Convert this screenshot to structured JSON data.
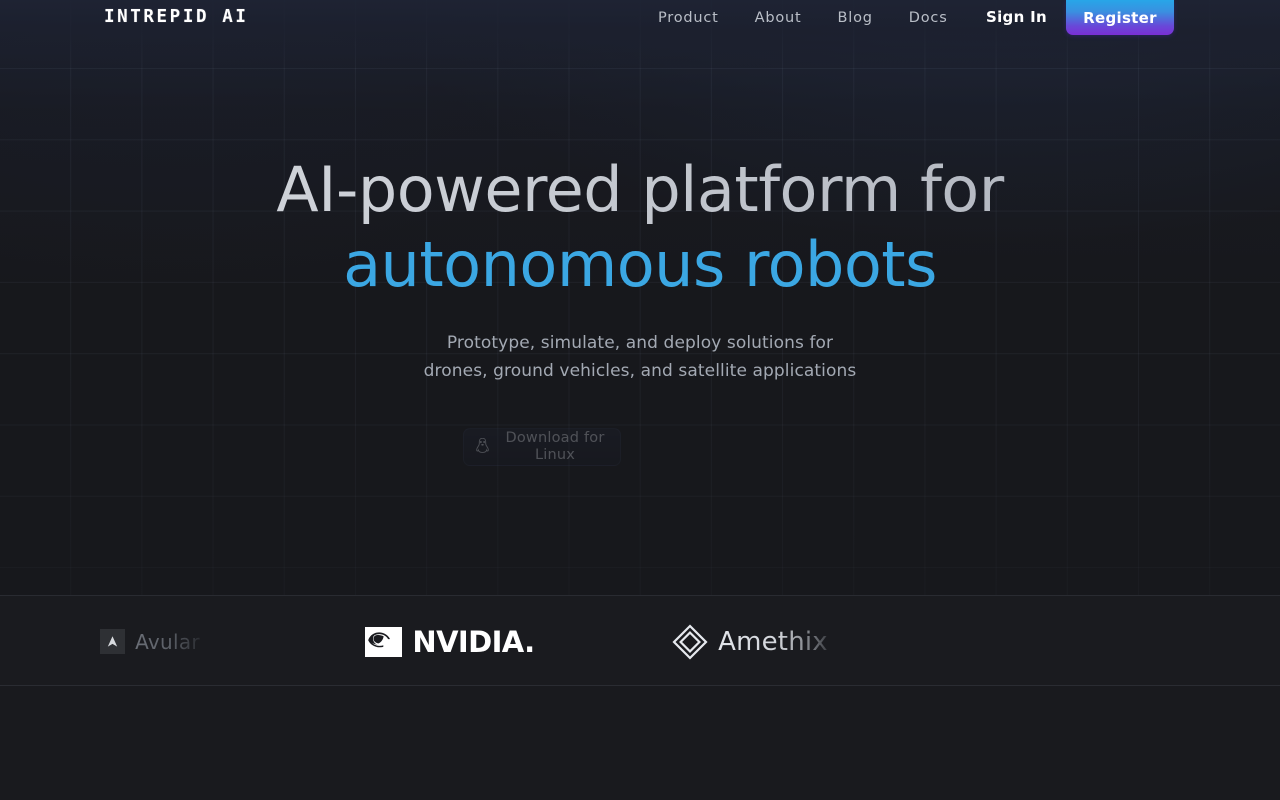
{
  "brand": {
    "logo_text": "INTREPID AI",
    "accent_blue": "#3ba7e3",
    "register_gradient_from": "#27a6e8",
    "register_gradient_to": "#7a2fd6",
    "page_background": "#17181c"
  },
  "header": {
    "nav": [
      {
        "label": "Product",
        "name": "nav-product"
      },
      {
        "label": "About",
        "name": "nav-about"
      },
      {
        "label": "Blog",
        "name": "nav-blog"
      },
      {
        "label": "Docs",
        "name": "nav-docs"
      }
    ],
    "sign_in_label": "Sign In",
    "register_label": "Register"
  },
  "hero": {
    "headline_line1": "AI-powered platform for",
    "headline_line2": "autonomous robots",
    "subtitle_line1": "Prototype, simulate, and deploy solutions for",
    "subtitle_line2": "drones, ground vehicles, and satellite applications",
    "download_label": "Download for Linux",
    "download_icon": "linux-penguin-icon"
  },
  "partners": {
    "items": [
      {
        "name": "Avular",
        "icon": "avular-triangle-icon"
      },
      {
        "name": "NVIDIA",
        "icon": "nvidia-eye-icon",
        "suffix": "."
      },
      {
        "name": "Amethix",
        "icon": "amethix-diamond-icon"
      }
    ]
  }
}
